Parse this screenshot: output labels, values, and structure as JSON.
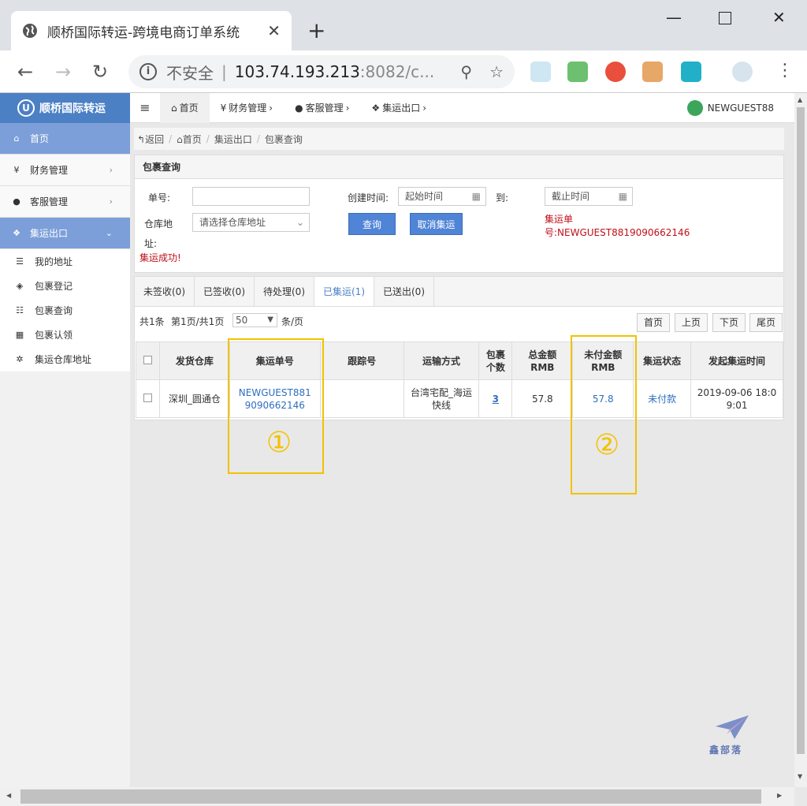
{
  "browser": {
    "tab_title": "顺桥国际转运-跨境电商订单系统",
    "insecure_label": "不安全",
    "url_host": "103.74.193.213",
    "url_rest": ":8082/c..."
  },
  "app": {
    "logo_text": "顺桥国际转运",
    "user_name": "NEWGUEST88",
    "topnav": [
      "首页",
      "财务管理",
      "客服管理",
      "集运出口"
    ],
    "sidebar": {
      "items": [
        {
          "label": "首页",
          "icon": "home-icon"
        },
        {
          "label": "财务管理",
          "icon": "yen-icon"
        },
        {
          "label": "客服管理",
          "icon": "user-icon"
        },
        {
          "label": "集运出口",
          "icon": "cubes-icon"
        }
      ],
      "subitems": [
        {
          "label": "我的地址",
          "icon": "list-icon"
        },
        {
          "label": "包裹登记",
          "icon": "package-icon"
        },
        {
          "label": "包裹查询",
          "icon": "list-alt-icon"
        },
        {
          "label": "包裹认领",
          "icon": "grid-icon"
        },
        {
          "label": "集运仓库地址",
          "icon": "gear-icon"
        }
      ]
    },
    "breadcrumb": [
      "返回",
      "首页",
      "集运出口",
      "包裹查询"
    ],
    "panel": {
      "title": "包裹查询",
      "order_label": "单号:",
      "created_label": "创建时间:",
      "start_placeholder": "起始时间",
      "to_label": "到:",
      "end_placeholder": "截止时间",
      "warehouse_label_1": "仓库地",
      "warehouse_label_2": "址:",
      "warehouse_select": "请选择仓库地址",
      "query_button": "查询",
      "cancel_button": "取消集运",
      "result_line1": "集运单",
      "result_line2": "号:NEWGUEST8819090662146",
      "success_message": "集运成功!"
    },
    "tabs": [
      "未签收(0)",
      "已签收(0)",
      "待处理(0)",
      "已集运(1)",
      "已送出(0)"
    ],
    "pagination": {
      "total": "共1条",
      "page_info": "第1页/共1页",
      "page_size": "50",
      "per_page_suffix": "条/页",
      "first": "首页",
      "prev": "上页",
      "next": "下页",
      "last": "尾页"
    },
    "table": {
      "headers": [
        "发货仓库",
        "集运单号",
        "跟踪号",
        "运输方式",
        "包裹个数",
        "总金额RMB",
        "未付金额RMB",
        "集运状态",
        "发起集运时间"
      ],
      "rows": [
        {
          "warehouse": "深圳_圆通仓",
          "order_no_1": "NEWGUEST881",
          "order_no_2": "9090662146",
          "tracking": "",
          "shipping_1": "台湾宅配_海运",
          "shipping_2": "快线",
          "packages": "3",
          "total": "57.8",
          "unpaid": "57.8",
          "status": "未付款",
          "time_1": "2019-09-06 18:0",
          "time_2": "9:01"
        }
      ]
    },
    "annotations": [
      "①",
      "②"
    ],
    "watermark": "鑫部落"
  }
}
